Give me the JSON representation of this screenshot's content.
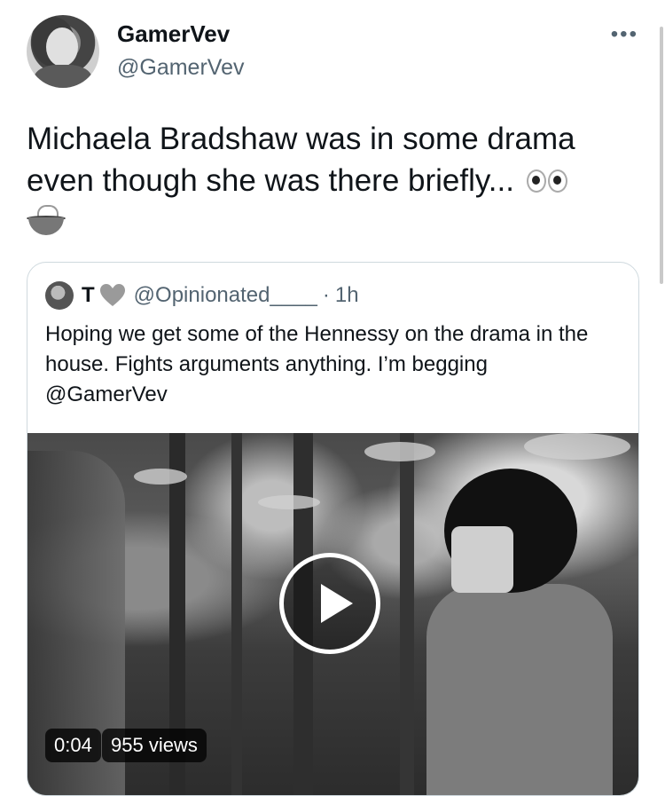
{
  "author": {
    "display_name": "GamerVev",
    "handle": "@GamerVev",
    "more_label": "•••"
  },
  "tweet": {
    "text": "Michaela Bradshaw was in some drama even though she was there briefly...",
    "emojis": [
      "eyes-emoji",
      "tea-emoji"
    ]
  },
  "quoted_tweet": {
    "name": "T",
    "handle": "@Opinionated____",
    "separator": "·",
    "time": "1h",
    "text": "Hoping we get some of the Hennessy on the drama in the house. Fights arguments anything. I’m begging @GamerVev",
    "video": {
      "duration": "0:04",
      "views": "955 views"
    }
  },
  "colors": {
    "text_primary": "#0f1419",
    "text_secondary": "#536471",
    "border": "#cfd9de"
  }
}
